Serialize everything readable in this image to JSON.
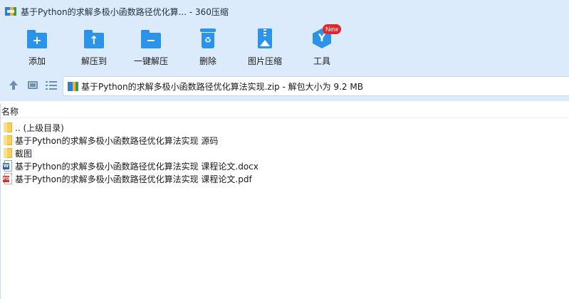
{
  "window": {
    "title": "基于Python的求解多极小函数路径优化算... - 360压缩"
  },
  "toolbar": {
    "items": [
      {
        "label": "添加",
        "icon": "add-folder-icon"
      },
      {
        "label": "解压到",
        "icon": "extract-to-folder-icon"
      },
      {
        "label": "一键解压",
        "icon": "one-click-extract-icon"
      },
      {
        "label": "删除",
        "icon": "trash-icon"
      },
      {
        "label": "图片压缩",
        "icon": "image-compress-icon"
      },
      {
        "label": "工具",
        "icon": "tools-icon",
        "badge": "New"
      }
    ]
  },
  "addressbar": {
    "path": "基于Python的求解多极小函数路径优化算法实现.zip - 解包大小为 9.2 MB"
  },
  "filelist": {
    "column_name": "名称",
    "rows": [
      {
        "name": ".. (上级目录)",
        "type": "folder"
      },
      {
        "name": "基于Python的求解多极小函数路径优化算法实现 源码",
        "type": "folder"
      },
      {
        "name": "截图",
        "type": "folder"
      },
      {
        "name": "基于Python的求解多极小函数路径优化算法实现 课程论文.docx",
        "type": "docx"
      },
      {
        "name": "基于Python的求解多极小函数路径优化算法实现 课程论文.pdf",
        "type": "pdf"
      }
    ]
  },
  "colors": {
    "chrome_bg": "#dcebfb",
    "icon_blue": "#2b94ea",
    "badge_red": "#e4262b",
    "folder_yellow": "#f6cf5c"
  }
}
